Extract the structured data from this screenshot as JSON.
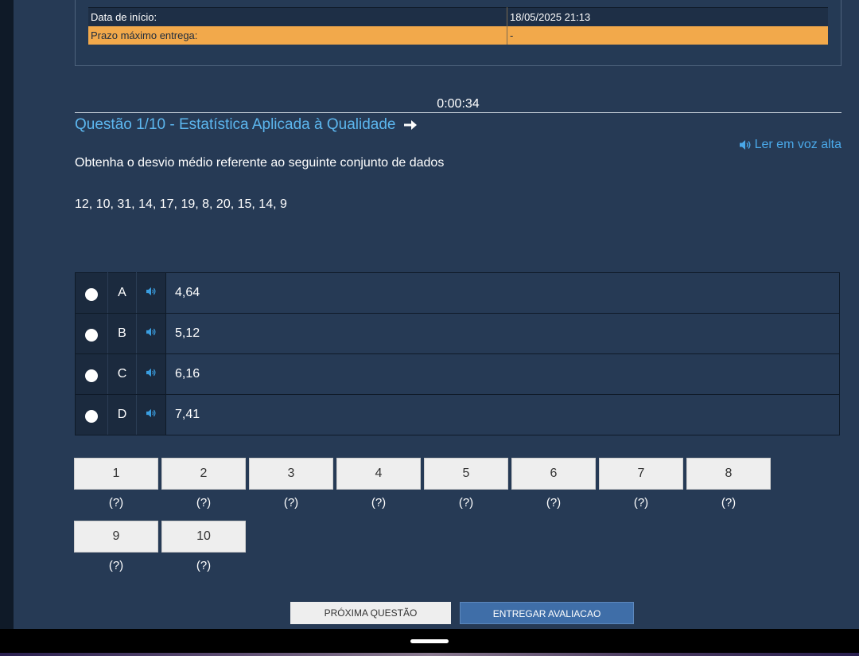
{
  "info": {
    "start_label": "Data de início:",
    "start_value": "18/05/2025 21:13",
    "deadline_label": "Prazo máximo entrega:",
    "deadline_value": "-"
  },
  "timer": "0:00:34",
  "question": {
    "title": "Questão 1/10 - Estatística Aplicada à Qualidade",
    "read_aloud": "Ler em voz alta",
    "text": "Obtenha o desvio médio referente ao seguinte conjunto de dados",
    "dataset": "12, 10, 31, 14, 17, 19, 8, 20, 15, 14, 9"
  },
  "options": [
    {
      "letter": "A",
      "value": "4,64"
    },
    {
      "letter": "B",
      "value": "5,12"
    },
    {
      "letter": "C",
      "value": "6,16"
    },
    {
      "letter": "D",
      "value": "7,41"
    }
  ],
  "question_nav": [
    {
      "number": "1",
      "status": "(?)"
    },
    {
      "number": "2",
      "status": "(?)"
    },
    {
      "number": "3",
      "status": "(?)"
    },
    {
      "number": "4",
      "status": "(?)"
    },
    {
      "number": "5",
      "status": "(?)"
    },
    {
      "number": "6",
      "status": "(?)"
    },
    {
      "number": "7",
      "status": "(?)"
    },
    {
      "number": "8",
      "status": "(?)"
    },
    {
      "number": "9",
      "status": "(?)"
    },
    {
      "number": "10",
      "status": "(?)"
    }
  ],
  "actions": {
    "next_label": "PRÓXIMA QUESTÃO",
    "submit_label": "ENTREGAR AVALIACAO"
  },
  "colors": {
    "background": "#263a55",
    "accent_link": "#5cb6ee",
    "deadline_row": "#f2a94b",
    "submit_button": "#3f6ea8"
  },
  "icons": {
    "title_arrow": "arrow-right-icon",
    "speaker": "speaker-icon",
    "radio": "radio-button"
  }
}
